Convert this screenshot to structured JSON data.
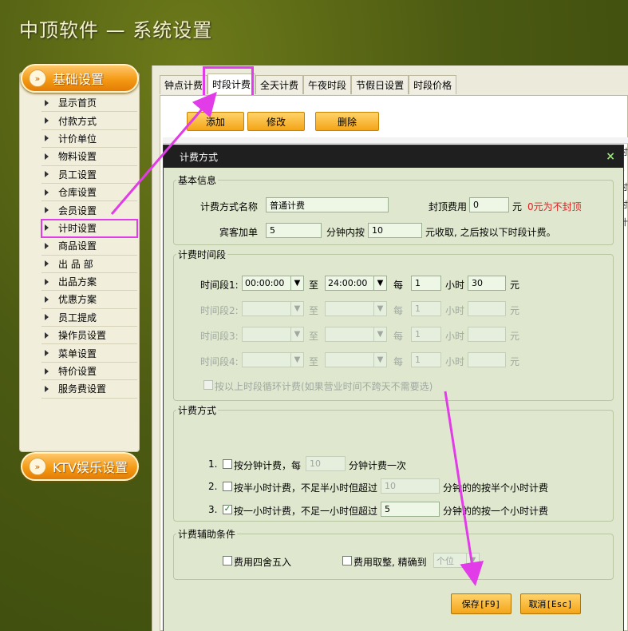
{
  "app": {
    "title": "中顶软件 — 系统设置"
  },
  "sidebar": {
    "base_label": "基础设置",
    "ktv_label": "KTV娱乐设置",
    "items": [
      {
        "label": "显示首页"
      },
      {
        "label": "付款方式"
      },
      {
        "label": "计价单位"
      },
      {
        "label": "物料设置"
      },
      {
        "label": "员工设置"
      },
      {
        "label": "仓库设置"
      },
      {
        "label": "会员设置"
      },
      {
        "label": "计时设置"
      },
      {
        "label": "商品设置"
      },
      {
        "label": "出 品 部"
      },
      {
        "label": "出品方案"
      },
      {
        "label": "优惠方案"
      },
      {
        "label": "员工提成"
      },
      {
        "label": "操作员设置"
      },
      {
        "label": "菜单设置"
      },
      {
        "label": "特价设置"
      },
      {
        "label": "服务费设置"
      }
    ],
    "active_index": 7
  },
  "tabs": [
    {
      "label": "钟点计费"
    },
    {
      "label": "时段计费"
    },
    {
      "label": "全天计费"
    },
    {
      "label": "午夜时段"
    },
    {
      "label": "节假日设置"
    },
    {
      "label": "时段价格"
    }
  ],
  "toolbar": {
    "add": "添加",
    "edit": "修改",
    "delete": "删除"
  },
  "grid_right": [
    "时",
    "3",
    "时",
    "时",
    "",
    "计"
  ],
  "dialog": {
    "title": "计费方式",
    "close": "×",
    "basic": {
      "legend": "基本信息",
      "name_label": "计费方式名称",
      "name_value": "普通计费",
      "cap_label": "封顶费用",
      "cap_value": "0",
      "cap_unit": "元",
      "cap_hint": "0元为不封顶",
      "guest_label": "宾客加单",
      "guest_value": "5",
      "within_label": "分钟内按",
      "within_value": "10",
      "within_suffix": "元收取, 之后按以下时段计费。"
    },
    "periods": {
      "legend": "计费时间段",
      "to": "至",
      "every": "每",
      "hour": "小时",
      "yuan": "元",
      "rows": [
        {
          "label": "时间段1:",
          "start": "00:00:00",
          "end": "24:00:00",
          "hours": "1",
          "price": "30",
          "enabled": true
        },
        {
          "label": "时间段2:",
          "start": "",
          "end": "",
          "hours": "1",
          "price": "",
          "enabled": false
        },
        {
          "label": "时间段3:",
          "start": "",
          "end": "",
          "hours": "1",
          "price": "",
          "enabled": false
        },
        {
          "label": "时间段4:",
          "start": "",
          "end": "",
          "hours": "1",
          "price": "",
          "enabled": false
        }
      ],
      "cycle_label": "按以上时段循环计费(如果营业时间不跨天不需要选)"
    },
    "method": {
      "legend": "计费方式",
      "opt1_num": "1.",
      "opt1_a": "按分钟计费，每",
      "opt1_value": "10",
      "opt1_b": "分钟计费一次",
      "opt2_num": "2.",
      "opt2_a": "按半小时计费，不足半小时但超过",
      "opt2_value": "10",
      "opt2_b": "分钟的的按半个小时计费",
      "opt3_num": "3.",
      "opt3_a": "按一小时计费，不足一小时但超过",
      "opt3_value": "5",
      "opt3_b": "分钟的的按一个小时计费",
      "opt3_checked": "✓"
    },
    "aux": {
      "legend": "计费辅助条件",
      "round_label": "费用四舍五入",
      "int_label": "费用取整, 精确到",
      "int_value": "个位"
    },
    "save": "保存[F9]",
    "cancel": "取消[Esc]"
  },
  "colors": {
    "highlight": "#e23ce8",
    "accent": "#f4a518",
    "title_bar": "#1f1f1f"
  }
}
